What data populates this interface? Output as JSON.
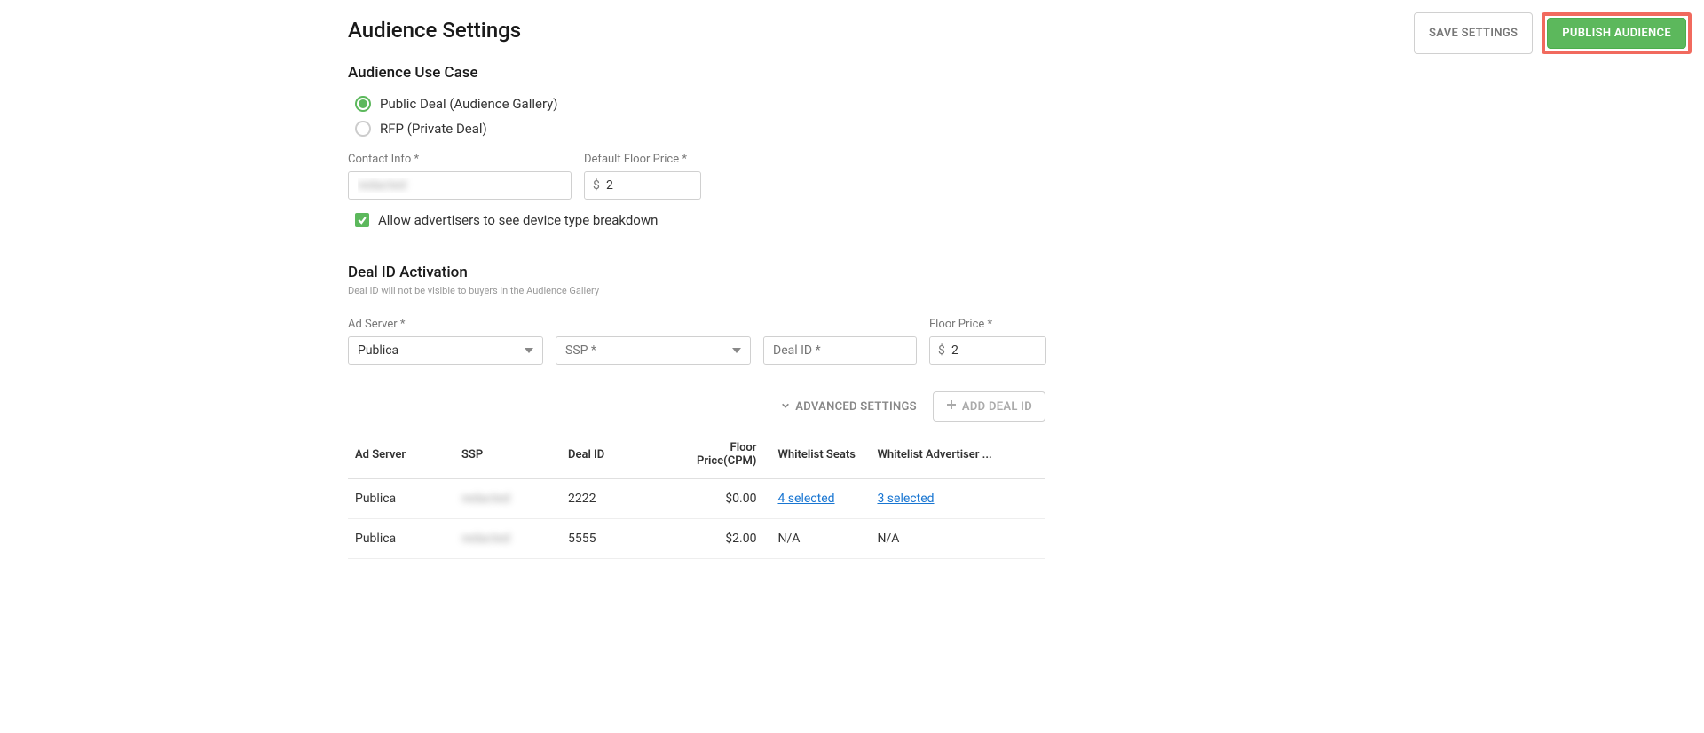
{
  "header": {
    "title": "Audience Settings",
    "save_label": "SAVE SETTINGS",
    "publish_label": "PUBLISH AUDIENCE"
  },
  "use_case": {
    "heading": "Audience Use Case",
    "options": {
      "public": "Public Deal (Audience Gallery)",
      "rfp": "RFP (Private Deal)"
    },
    "selected": "public",
    "contact_label": "Contact Info *",
    "contact_value": "redacted",
    "floor_label": "Default Floor Price *",
    "floor_currency": "$",
    "floor_value": "2",
    "allow_breakdown_label": "Allow advertisers to see device type breakdown"
  },
  "deal_id": {
    "heading": "Deal ID Activation",
    "note": "Deal ID will not be visible to buyers in the Audience Gallery",
    "ad_server_label": "Ad Server *",
    "ad_server_value": "Publica",
    "ssp_placeholder": "SSP *",
    "deal_id_placeholder": "Deal ID *",
    "floor_label": "Floor Price *",
    "floor_currency": "$",
    "floor_value": "2",
    "advanced_label": "ADVANCED SETTINGS",
    "add_label": "ADD DEAL ID"
  },
  "table": {
    "headers": {
      "ad_server": "Ad Server",
      "ssp": "SSP",
      "deal_id": "Deal ID",
      "floor": "Floor Price(CPM)",
      "seats": "Whitelist Seats",
      "advertiser": "Whitelist Advertiser ..."
    },
    "rows": [
      {
        "ad_server": "Publica",
        "ssp": "redacted",
        "deal_id": "2222",
        "floor": "$0.00",
        "seats": "4 selected",
        "advertiser": "3 selected",
        "seats_link": true,
        "adv_link": true
      },
      {
        "ad_server": "Publica",
        "ssp": "redacted",
        "deal_id": "5555",
        "floor": "$2.00",
        "seats": "N/A",
        "advertiser": "N/A",
        "seats_link": false,
        "adv_link": false
      }
    ]
  }
}
